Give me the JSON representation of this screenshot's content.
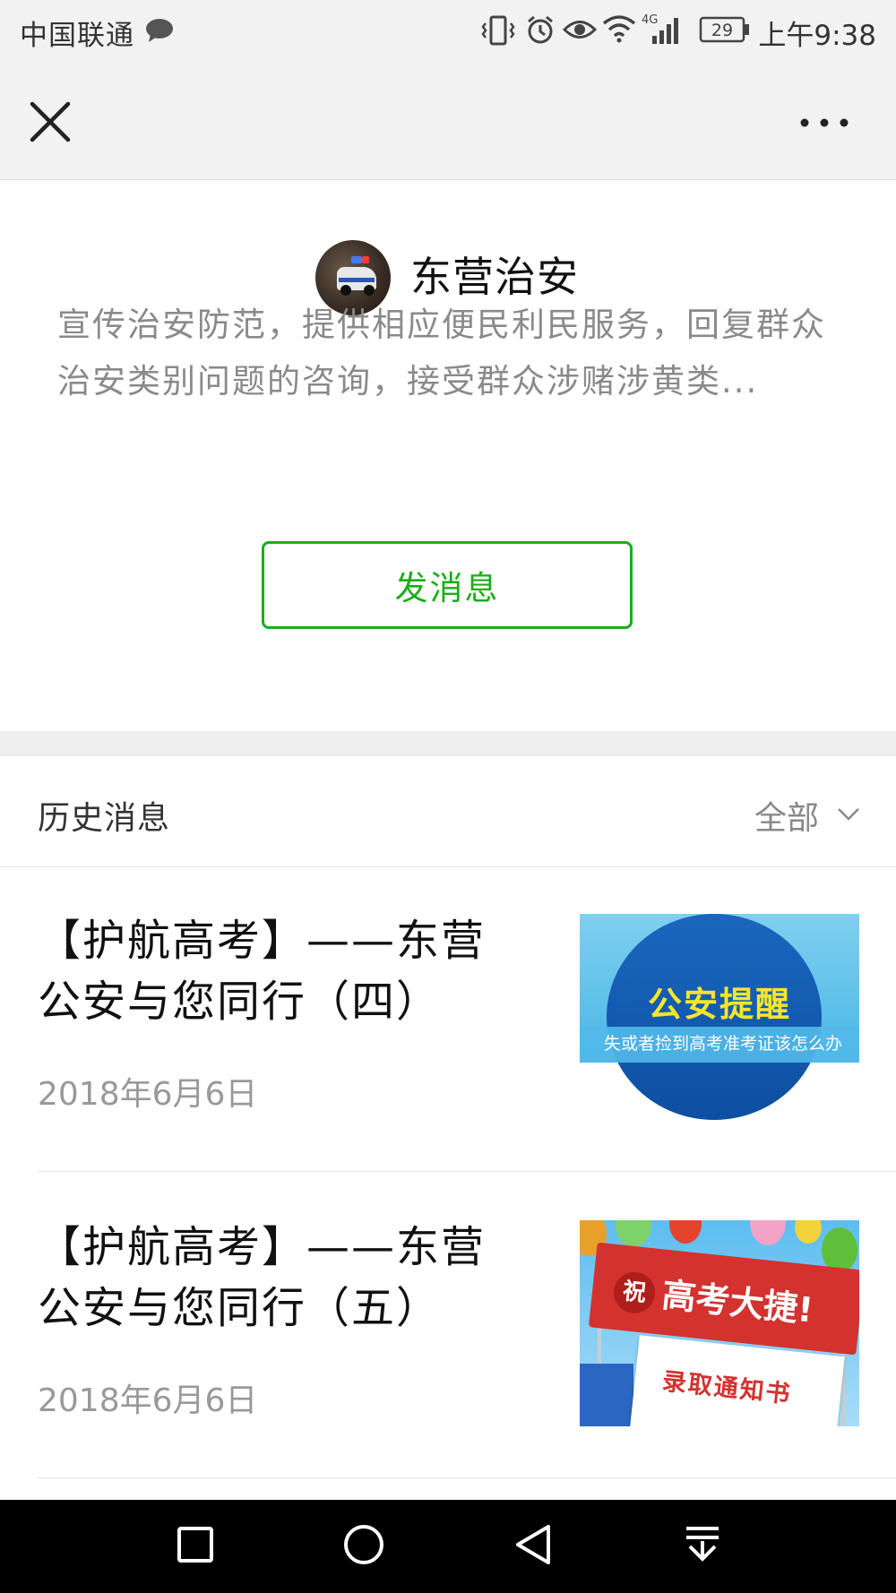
{
  "status_bar": {
    "carrier": "中国联通",
    "battery": "29",
    "network": "4G",
    "time": "上午9:38",
    "icons": [
      "chat-bubble-icon",
      "vibrate-icon",
      "alarm-icon",
      "eye-icon",
      "wifi-icon",
      "signal-icon",
      "battery-icon"
    ]
  },
  "nav": {
    "close_icon": "close-icon",
    "more_icon": "more-icon"
  },
  "profile": {
    "name": "东营治安",
    "description": "宣传治安防范，提供相应便民利民服务，回复群众治安类别问题的咨询，接受群众涉赌涉黄类...",
    "send_button": "发消息"
  },
  "history": {
    "title": "历史消息",
    "filter": "全部",
    "articles": [
      {
        "title": "【护航高考】——东营公安与您同行（四）",
        "date": "2018年6月6日",
        "thumb_headline": "公安提醒",
        "thumb_sub": "失或者捡到高考准考证该怎么办"
      },
      {
        "title": "【护航高考】——东营公安与您同行（五）",
        "date": "2018年6月6日",
        "thumb_zhu": "祝",
        "thumb_banner": "高考大捷!",
        "thumb_paper": "录取通知书"
      }
    ]
  },
  "system_nav": {
    "icons": [
      "recent-apps-icon",
      "home-icon",
      "back-icon",
      "notification-pull-icon"
    ]
  },
  "colors": {
    "accent_green": "#1aad19",
    "bar_gray": "#f2f2f2"
  }
}
